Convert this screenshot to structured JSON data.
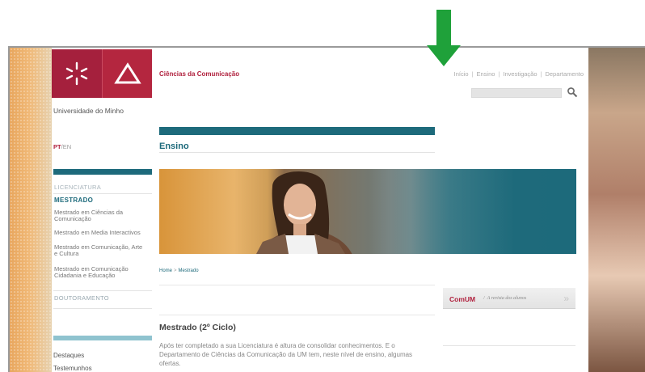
{
  "colors": {
    "brand_red": "#b0203d",
    "teal": "#1d6a7b",
    "light_teal": "#8fc3cf",
    "annotation_green": "#1fa13a"
  },
  "header": {
    "university": "Universidade do Minho",
    "department": "Ciências da Comunicação",
    "nav": [
      {
        "label": "Início"
      },
      {
        "label": "Ensino"
      },
      {
        "label": "Investigação"
      },
      {
        "label": "Departamento"
      }
    ],
    "nav_separator": "|",
    "search_icon": "magnifier-icon"
  },
  "language": {
    "pt": "PT",
    "sep": "/",
    "en": "EN"
  },
  "sidebar": {
    "licenciatura": "LICENCIATURA",
    "mestrado": "MESTRADO",
    "items": [
      {
        "label": "Mestrado em Ciências da Comunicação"
      },
      {
        "label": "Mestrado em Media Interactivos"
      },
      {
        "label": "Mestrado em Comunicação, Arte e Cultura"
      },
      {
        "label": "Mestrado em Comunicação Cidadania e Educação"
      }
    ],
    "doutoramento": "DOUTORAMENTO",
    "destaques": "Destaques",
    "testemunhos": "Testemunhos"
  },
  "main": {
    "section_title": "Ensino",
    "breadcrumb": {
      "home": "Home",
      "sep": ">",
      "current": "Mestrado"
    },
    "content_title": "Mestrado (2º Ciclo)",
    "content_text": "Após ter completado a sua Licenciatura é altura de consolidar conhecimentos. E o Departamento de Ciências da Comunicação da UM tem, neste nível de ensino, algumas ofertas."
  },
  "comum": {
    "label": "ComUM",
    "sep": "/",
    "subtitle": "A revista dos alunos",
    "chevron": "»"
  }
}
